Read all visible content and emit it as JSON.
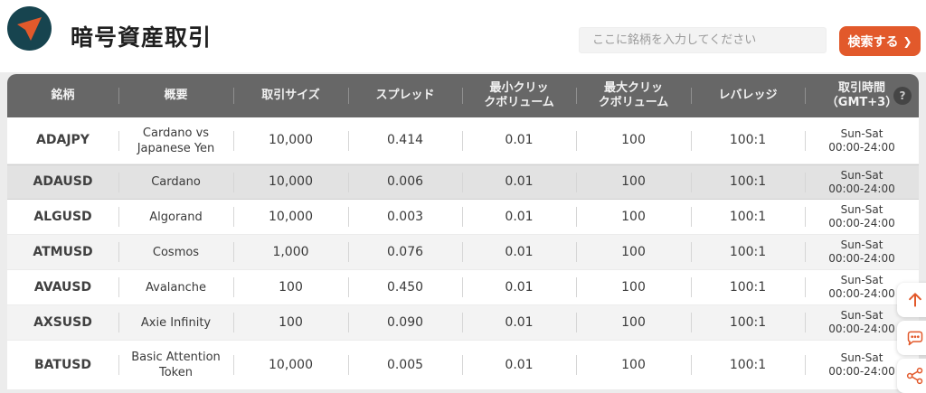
{
  "header": {
    "title": "暗号資産取引",
    "search_placeholder": "ここに銘柄を入力してください",
    "search_button_label": "検索する",
    "search_button_arrow": "❯"
  },
  "colors": {
    "accent_orange": "#e2592b",
    "logo_teal": "#17444f",
    "table_header_bg": "#676767",
    "row_alt_bg": "#f3f3f3",
    "row_hover_bg": "#e2e2e2",
    "page_bg": "#ececec"
  },
  "table": {
    "help_icon": "?",
    "columns": [
      {
        "line1": "銘柄"
      },
      {
        "line1": "概要"
      },
      {
        "line1": "取引サイズ"
      },
      {
        "line1": "スプレッド"
      },
      {
        "line1": "最小クリッ",
        "line2": "クボリューム"
      },
      {
        "line1": "最大クリッ",
        "line2": "クボリューム"
      },
      {
        "line1": "レバレッジ"
      },
      {
        "line1": "取引時間",
        "line2": "（GMT+3）"
      }
    ],
    "rows": [
      {
        "symbol": "ADAJPY",
        "description": "Cardano vs Japanese Yen",
        "trade_size": "10,000",
        "spread": "0.414",
        "min_click": "0.01",
        "max_click": "100",
        "leverage": "100:1",
        "hours1": "Sun-Sat",
        "hours2": "00:00-24:00"
      },
      {
        "symbol": "ADAUSD",
        "description": "Cardano",
        "trade_size": "10,000",
        "spread": "0.006",
        "min_click": "0.01",
        "max_click": "100",
        "leverage": "100:1",
        "hours1": "Sun-Sat",
        "hours2": "00:00-24:00"
      },
      {
        "symbol": "ALGUSD",
        "description": "Algorand",
        "trade_size": "10,000",
        "spread": "0.003",
        "min_click": "0.01",
        "max_click": "100",
        "leverage": "100:1",
        "hours1": "Sun-Sat",
        "hours2": "00:00-24:00"
      },
      {
        "symbol": "ATMUSD",
        "description": "Cosmos",
        "trade_size": "1,000",
        "spread": "0.076",
        "min_click": "0.01",
        "max_click": "100",
        "leverage": "100:1",
        "hours1": "Sun-Sat",
        "hours2": "00:00-24:00"
      },
      {
        "symbol": "AVAUSD",
        "description": "Avalanche",
        "trade_size": "100",
        "spread": "0.450",
        "min_click": "0.01",
        "max_click": "100",
        "leverage": "100:1",
        "hours1": "Sun-Sat",
        "hours2": "00:00-24:00"
      },
      {
        "symbol": "AXSUSD",
        "description": "Axie Infinity",
        "trade_size": "100",
        "spread": "0.090",
        "min_click": "0.01",
        "max_click": "100",
        "leverage": "100:1",
        "hours1": "Sun-Sat",
        "hours2": "00:00-24:00"
      },
      {
        "symbol": "BATUSD",
        "description": "Basic Attention Token",
        "trade_size": "10,000",
        "spread": "0.005",
        "min_click": "0.01",
        "max_click": "100",
        "leverage": "100:1",
        "hours1": "Sun-Sat",
        "hours2": "00:00-24:00"
      }
    ]
  },
  "floating_buttons": {
    "scroll_top": "scroll-to-top",
    "chat": "chat",
    "share": "share"
  }
}
